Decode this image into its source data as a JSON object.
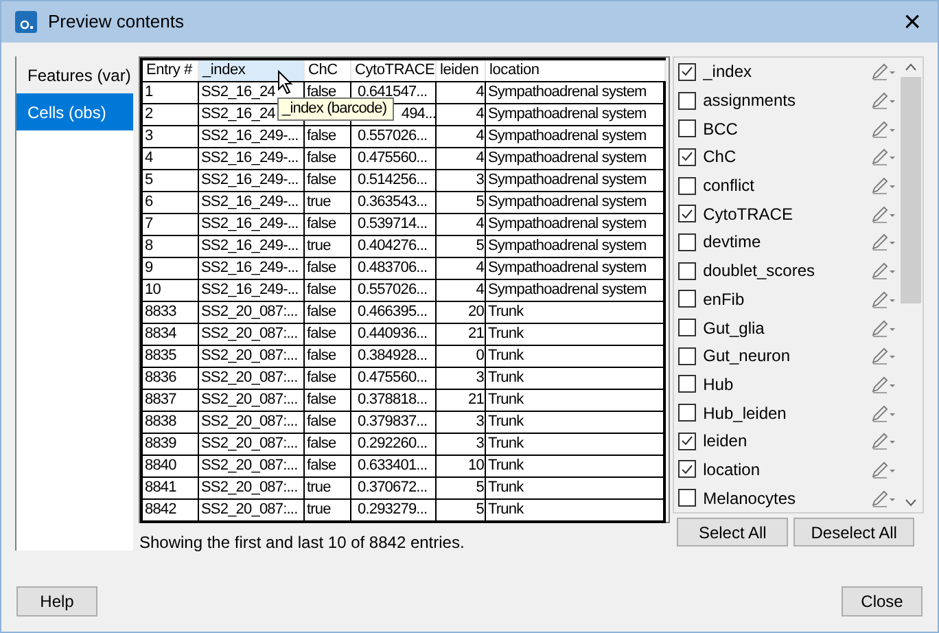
{
  "window": {
    "title": "Preview contents",
    "close": "×"
  },
  "tabs": [
    {
      "label": "Features (var)",
      "selected": false
    },
    {
      "label": "Cells (obs)",
      "selected": true
    }
  ],
  "table": {
    "columns": [
      {
        "label": "Entry #",
        "hovered": false
      },
      {
        "label": "_index",
        "hovered": true
      },
      {
        "label": "ChC",
        "hovered": false
      },
      {
        "label": "CytoTRACE",
        "hovered": false
      },
      {
        "label": "leiden",
        "hovered": false
      },
      {
        "label": "location",
        "hovered": false
      }
    ],
    "rows": [
      {
        "entry": "1",
        "index": "SS2_16_24",
        "chc": "false",
        "cyto": "0.641547...",
        "leiden": "4",
        "location": "Sympathoadrenal system"
      },
      {
        "entry": "2",
        "index": "SS2_16_24",
        "cyto": "494...",
        "cyto_covered": true,
        "leiden": "4",
        "location": "Sympathoadrenal system"
      },
      {
        "entry": "3",
        "index": "SS2_16_249-...",
        "chc": "false",
        "cyto": "0.557026...",
        "leiden": "4",
        "location": "Sympathoadrenal system"
      },
      {
        "entry": "4",
        "index": "SS2_16_249-...",
        "chc": "false",
        "cyto": "0.475560...",
        "leiden": "4",
        "location": "Sympathoadrenal system"
      },
      {
        "entry": "5",
        "index": "SS2_16_249-...",
        "chc": "false",
        "cyto": "0.514256...",
        "leiden": "3",
        "location": "Sympathoadrenal system"
      },
      {
        "entry": "6",
        "index": "SS2_16_249-...",
        "chc": "true",
        "cyto": "0.363543...",
        "leiden": "5",
        "location": "Sympathoadrenal system"
      },
      {
        "entry": "7",
        "index": "SS2_16_249-...",
        "chc": "false",
        "cyto": "0.539714...",
        "leiden": "4",
        "location": "Sympathoadrenal system"
      },
      {
        "entry": "8",
        "index": "SS2_16_249-...",
        "chc": "true",
        "cyto": "0.404276...",
        "leiden": "5",
        "location": "Sympathoadrenal system"
      },
      {
        "entry": "9",
        "index": "SS2_16_249-...",
        "chc": "false",
        "cyto": "0.483706...",
        "leiden": "4",
        "location": "Sympathoadrenal system"
      },
      {
        "entry": "10",
        "index": "SS2_16_249-...",
        "chc": "false",
        "cyto": "0.557026...",
        "leiden": "4",
        "location": "Sympathoadrenal system"
      },
      {
        "entry": "8833",
        "index": "SS2_20_087:...",
        "chc": "false",
        "cyto": "0.466395...",
        "leiden": "20",
        "location": "Trunk"
      },
      {
        "entry": "8834",
        "index": "SS2_20_087:...",
        "chc": "false",
        "cyto": "0.440936...",
        "leiden": "21",
        "location": "Trunk"
      },
      {
        "entry": "8835",
        "index": "SS2_20_087:...",
        "chc": "false",
        "cyto": "0.384928...",
        "leiden": "0",
        "location": "Trunk"
      },
      {
        "entry": "8836",
        "index": "SS2_20_087:...",
        "chc": "false",
        "cyto": "0.475560...",
        "leiden": "3",
        "location": "Trunk"
      },
      {
        "entry": "8837",
        "index": "SS2_20_087:...",
        "chc": "false",
        "cyto": "0.378818...",
        "leiden": "21",
        "location": "Trunk"
      },
      {
        "entry": "8838",
        "index": "SS2_20_087:...",
        "chc": "false",
        "cyto": "0.379837...",
        "leiden": "3",
        "location": "Trunk"
      },
      {
        "entry": "8839",
        "index": "SS2_20_087:...",
        "chc": "false",
        "cyto": "0.292260...",
        "leiden": "3",
        "location": "Trunk"
      },
      {
        "entry": "8840",
        "index": "SS2_20_087:...",
        "chc": "false",
        "cyto": "0.633401...",
        "leiden": "10",
        "location": "Trunk"
      },
      {
        "entry": "8841",
        "index": "SS2_20_087:...",
        "chc": "true",
        "cyto": "0.370672...",
        "leiden": "5",
        "location": "Trunk"
      },
      {
        "entry": "8842",
        "index": "SS2_20_087:...",
        "chc": "true",
        "cyto": "0.293279...",
        "leiden": "5",
        "location": "Trunk"
      }
    ],
    "tooltip": "_index (barcode)"
  },
  "status": "Showing the first and last 10 of 8842 entries.",
  "fields": [
    {
      "label": "_index",
      "checked": true
    },
    {
      "label": "assignments",
      "checked": false
    },
    {
      "label": "BCC",
      "checked": false
    },
    {
      "label": "ChC",
      "checked": true
    },
    {
      "label": "conflict",
      "checked": false
    },
    {
      "label": "CytoTRACE",
      "checked": true
    },
    {
      "label": "devtime",
      "checked": false
    },
    {
      "label": "doublet_scores",
      "checked": false
    },
    {
      "label": "enFib",
      "checked": false
    },
    {
      "label": "Gut_glia",
      "checked": false
    },
    {
      "label": "Gut_neuron",
      "checked": false
    },
    {
      "label": "Hub",
      "checked": false
    },
    {
      "label": "Hub_leiden",
      "checked": false
    },
    {
      "label": "leiden",
      "checked": true
    },
    {
      "label": "location",
      "checked": true
    },
    {
      "label": "Melanocytes",
      "checked": false
    }
  ],
  "field_buttons": [
    "Select All",
    "Deselect All"
  ],
  "buttons": {
    "help": "Help",
    "close": "Close"
  }
}
